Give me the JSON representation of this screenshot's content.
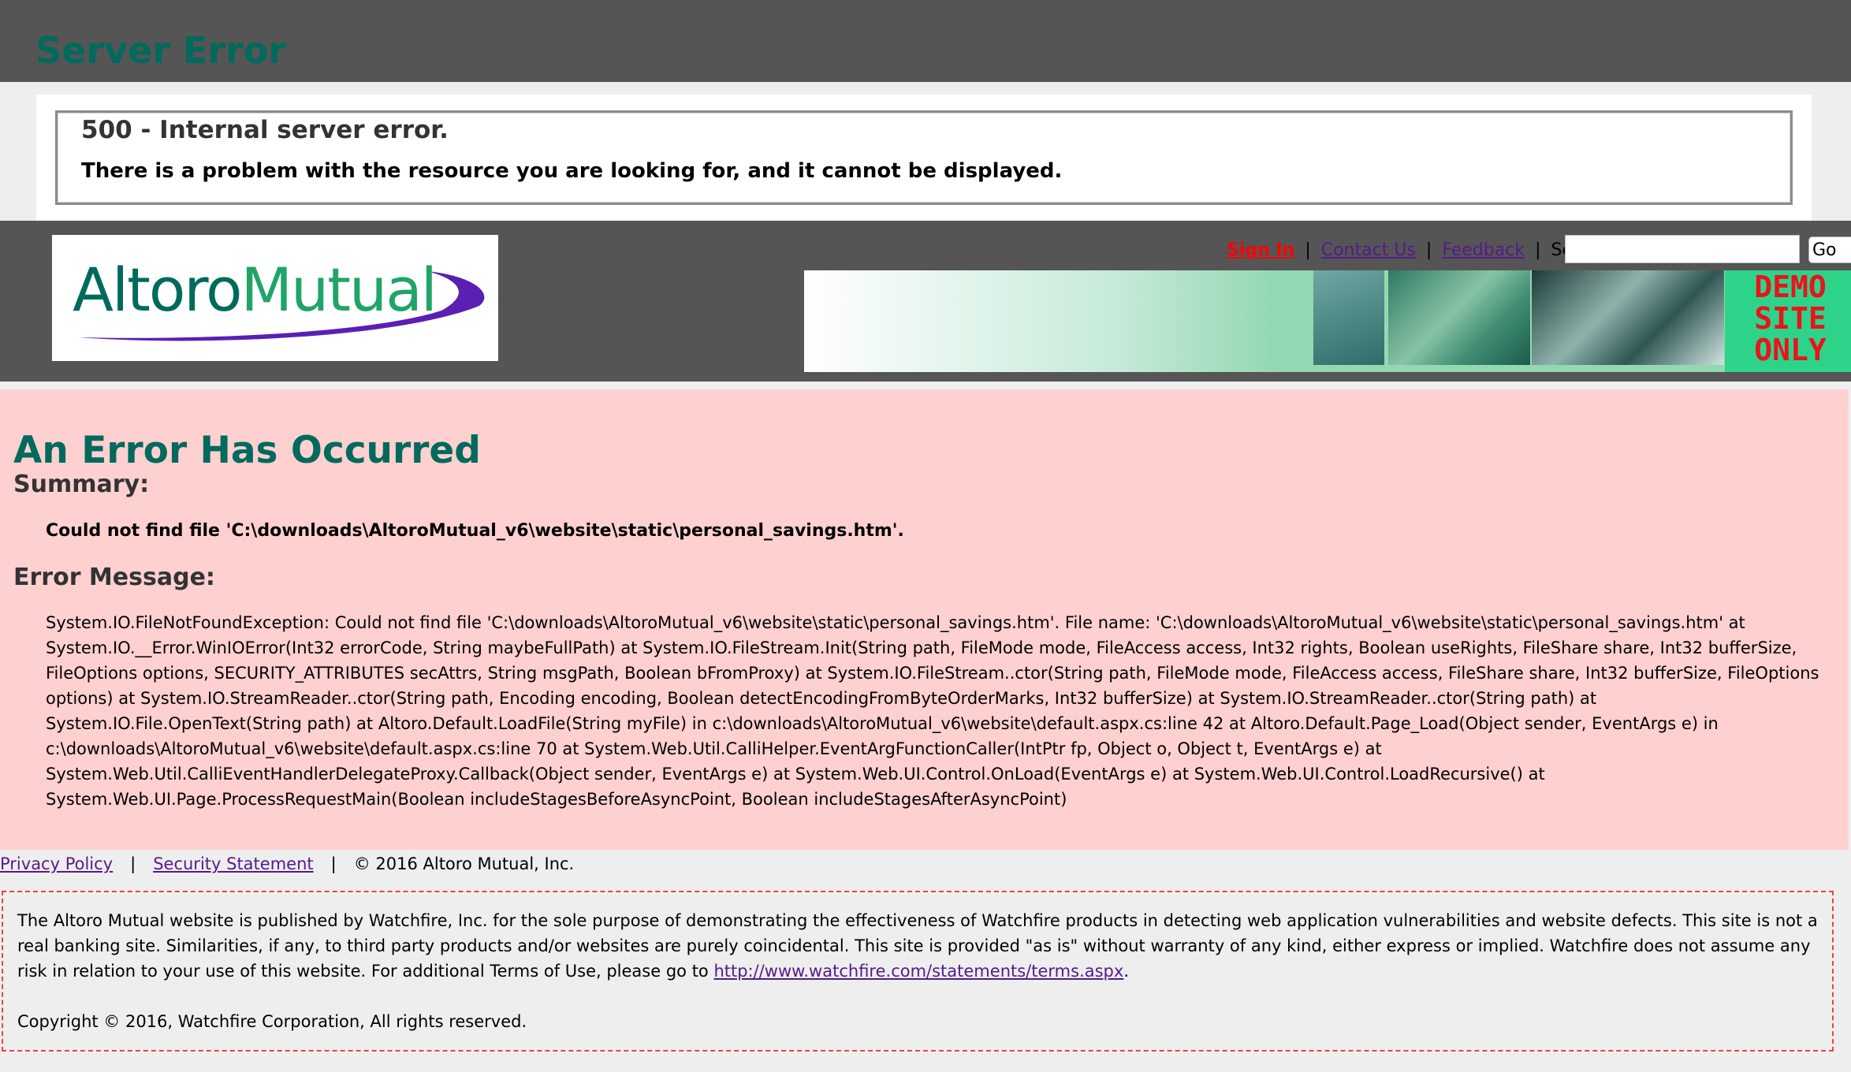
{
  "server_error": {
    "title": "Server Error",
    "error_title": "500 - Internal server error.",
    "error_description": "There is a problem with the resource you are looking for, and it cannot be displayed."
  },
  "header": {
    "logo_word1": "Altoro",
    "logo_word2": "Mutual",
    "nav": {
      "sign_in": "Sign In",
      "separator": "|",
      "contact_us": "Contact Us",
      "feedback": "Feedback",
      "search_label": "Search"
    },
    "search": {
      "value": "",
      "button": "Go"
    },
    "banner_text": "DEMO\nSITE\nONLY"
  },
  "error_page": {
    "heading": "An Error Has Occurred",
    "summary_heading": "Summary:",
    "summary_text": "Could not find file 'C:\\downloads\\AltoroMutual_v6\\website\\static\\personal_savings.htm'.",
    "message_heading": "Error Message:",
    "message_text": "System.IO.FileNotFoundException: Could not find file 'C:\\downloads\\AltoroMutual_v6\\website\\static\\personal_savings.htm'. File name: 'C:\\downloads\\AltoroMutual_v6\\website\\static\\personal_savings.htm' at System.IO.__Error.WinIOError(Int32 errorCode, String maybeFullPath) at System.IO.FileStream.Init(String path, FileMode mode, FileAccess access, Int32 rights, Boolean useRights, FileShare share, Int32 bufferSize, FileOptions options, SECURITY_ATTRIBUTES secAttrs, String msgPath, Boolean bFromProxy) at System.IO.FileStream..ctor(String path, FileMode mode, FileAccess access, FileShare share, Int32 bufferSize, FileOptions options) at System.IO.StreamReader..ctor(String path, Encoding encoding, Boolean detectEncodingFromByteOrderMarks, Int32 bufferSize) at System.IO.StreamReader..ctor(String path) at System.IO.File.OpenText(String path) at Altoro.Default.LoadFile(String myFile) in c:\\downloads\\AltoroMutual_v6\\website\\default.aspx.cs:line 42 at Altoro.Default.Page_Load(Object sender, EventArgs e) in c:\\downloads\\AltoroMutual_v6\\website\\default.aspx.cs:line 70 at System.Web.Util.CalliHelper.EventArgFunctionCaller(IntPtr fp, Object o, Object t, EventArgs e) at System.Web.Util.CalliEventHandlerDelegateProxy.Callback(Object sender, EventArgs e) at System.Web.UI.Control.OnLoad(EventArgs e) at System.Web.UI.Control.LoadRecursive() at System.Web.UI.Page.ProcessRequestMain(Boolean includeStagesBeforeAsyncPoint, Boolean includeStagesAfterAsyncPoint)"
  },
  "footer": {
    "privacy_policy": "Privacy Policy",
    "separator": "|",
    "security_statement": "Security Statement",
    "copyright": "© 2016 Altoro Mutual, Inc.",
    "disclaimer_text": "The Altoro Mutual website is published by Watchfire, Inc. for the sole purpose of demonstrating the effectiveness of Watchfire products in detecting web application vulnerabilities and website defects. This site is not a real banking site. Similarities, if any, to third party products and/or websites are purely coincidental. This site is provided \"as is\" without warranty of any kind, either express or implied. Watchfire does not assume any risk in relation to your use of this website. For additional Terms of Use, please go to ",
    "terms_link": "http://www.watchfire.com/statements/terms.aspx",
    "terms_suffix": ".",
    "disclaimer_copyright": "Copyright © 2016, Watchfire Corporation, All rights reserved."
  },
  "colors": {
    "header_bg": "#555555",
    "title_green": "#006a5c",
    "error_panel_bg": "#ffd0d0",
    "signin_red": "#ff0000",
    "link_purple": "#551a8b",
    "dashed_border": "#e4444a"
  }
}
